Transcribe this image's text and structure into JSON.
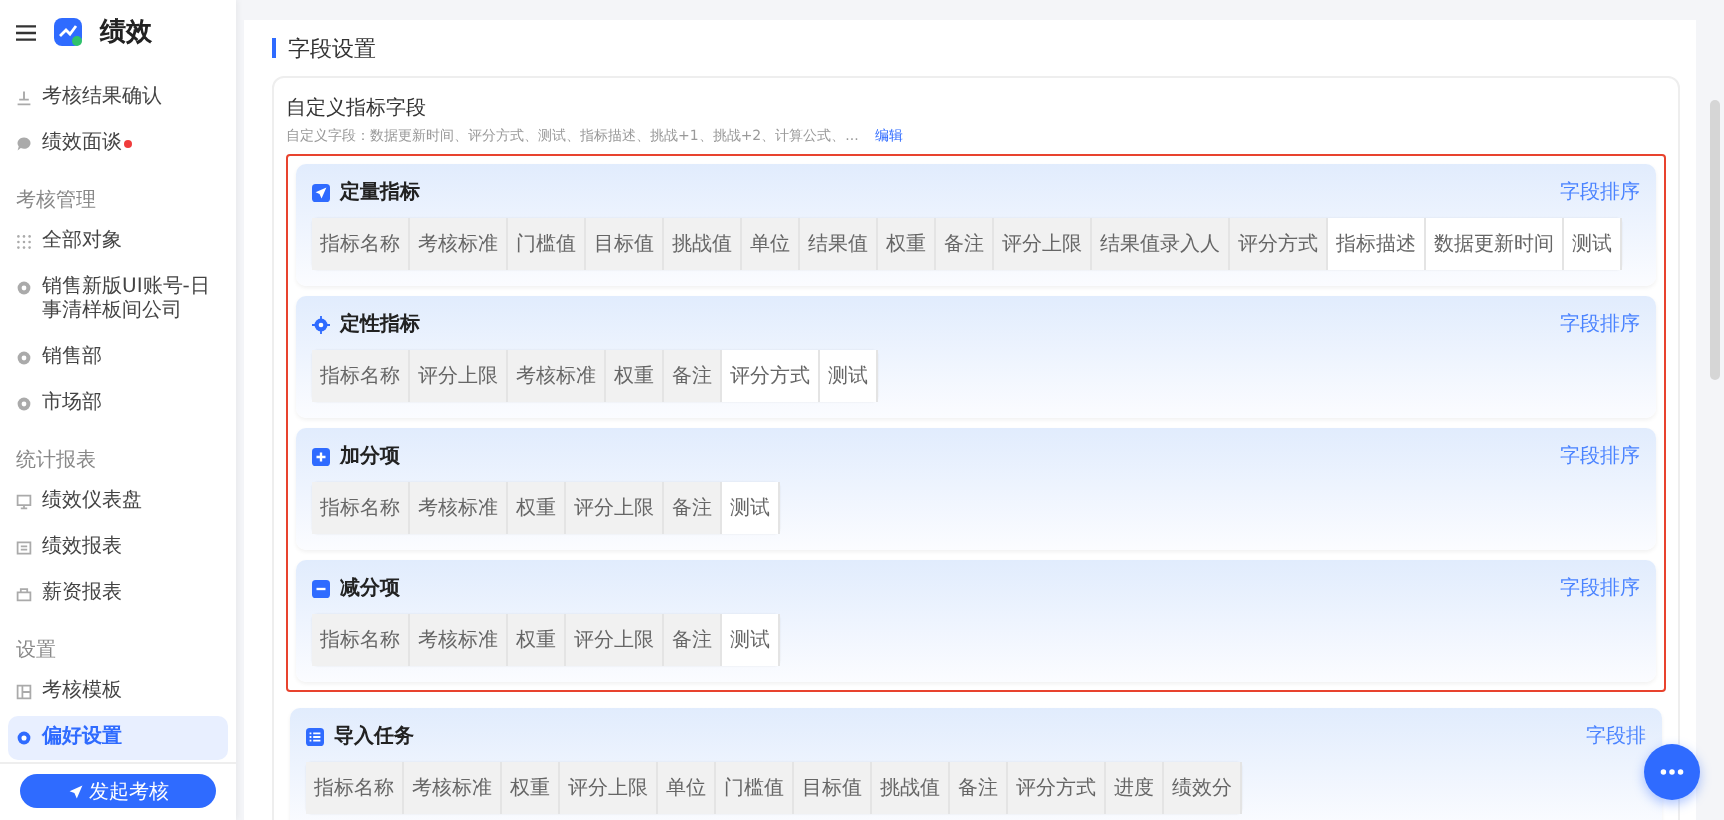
{
  "app": {
    "title": "绩效"
  },
  "sidebar": {
    "items": [
      {
        "label": "考核结果确认",
        "kind": "confirm",
        "selected": false,
        "dot": false
      },
      {
        "label": "绩效面谈",
        "kind": "chat",
        "selected": false,
        "dot": true
      }
    ],
    "groups": [
      {
        "label": "考核管理",
        "items": [
          {
            "label": "全部对象",
            "kind": "grid",
            "selected": false,
            "dot": false
          },
          {
            "label": "销售新版UI账号-日事清样板间公司",
            "kind": "org",
            "selected": false,
            "dot": false
          },
          {
            "label": "销售部",
            "kind": "org",
            "selected": false,
            "dot": false
          },
          {
            "label": "市场部",
            "kind": "org",
            "selected": false,
            "dot": false
          }
        ]
      },
      {
        "label": "统计报表",
        "items": [
          {
            "label": "绩效仪表盘",
            "kind": "monitor",
            "selected": false,
            "dot": false
          },
          {
            "label": "绩效报表",
            "kind": "report",
            "selected": false,
            "dot": false
          },
          {
            "label": "薪资报表",
            "kind": "wallet",
            "selected": false,
            "dot": false
          }
        ]
      },
      {
        "label": "设置",
        "items": [
          {
            "label": "考核模板",
            "kind": "template",
            "selected": false,
            "dot": false
          },
          {
            "label": "偏好设置",
            "kind": "gear",
            "selected": true,
            "dot": false
          }
        ]
      }
    ],
    "button": "发起考核"
  },
  "page": {
    "title": "字段设置",
    "custom": {
      "title": "自定义指标字段",
      "description": "自定义字段：数据更新时间、评分方式、测试、指标描述、挑战+1、挑战+2、计算公式、...",
      "link": "编辑"
    },
    "sections": [
      {
        "title": "定量指标",
        "kind": "quantitative",
        "highlighted": true,
        "sort": "字段排序",
        "fields": [
          {
            "label": "指标名称",
            "custom": false
          },
          {
            "label": "考核标准",
            "custom": false
          },
          {
            "label": "门槛值",
            "custom": false
          },
          {
            "label": "目标值",
            "custom": false
          },
          {
            "label": "挑战值",
            "custom": false
          },
          {
            "label": "单位",
            "custom": false
          },
          {
            "label": "结果值",
            "custom": false
          },
          {
            "label": "权重",
            "custom": false
          },
          {
            "label": "备注",
            "custom": false
          },
          {
            "label": "评分上限",
            "custom": false
          },
          {
            "label": "结果值录入人",
            "custom": false
          },
          {
            "label": "评分方式",
            "custom": false
          },
          {
            "label": "指标描述",
            "custom": true
          },
          {
            "label": "数据更新时间",
            "custom": true
          },
          {
            "label": "测试",
            "custom": true
          }
        ]
      },
      {
        "title": "定性指标",
        "kind": "qualitative",
        "highlighted": true,
        "sort": "字段排序",
        "fields": [
          {
            "label": "指标名称",
            "custom": false
          },
          {
            "label": "评分上限",
            "custom": false
          },
          {
            "label": "考核标准",
            "custom": false
          },
          {
            "label": "权重",
            "custom": false
          },
          {
            "label": "备注",
            "custom": false
          },
          {
            "label": "评分方式",
            "custom": true
          },
          {
            "label": "测试",
            "custom": true
          }
        ]
      },
      {
        "title": "加分项",
        "kind": "bonus",
        "highlighted": true,
        "sort": "字段排序",
        "fields": [
          {
            "label": "指标名称",
            "custom": false
          },
          {
            "label": "考核标准",
            "custom": false
          },
          {
            "label": "权重",
            "custom": false
          },
          {
            "label": "评分上限",
            "custom": false
          },
          {
            "label": "备注",
            "custom": false
          },
          {
            "label": "测试",
            "custom": true
          }
        ]
      },
      {
        "title": "减分项",
        "kind": "deduction",
        "highlighted": true,
        "sort": "字段排序",
        "fields": [
          {
            "label": "指标名称",
            "custom": false
          },
          {
            "label": "考核标准",
            "custom": false
          },
          {
            "label": "权重",
            "custom": false
          },
          {
            "label": "评分上限",
            "custom": false
          },
          {
            "label": "备注",
            "custom": false
          },
          {
            "label": "测试",
            "custom": true
          }
        ]
      },
      {
        "title": "导入任务",
        "kind": "import",
        "highlighted": false,
        "sort": "字段排",
        "fields": [
          {
            "label": "指标名称",
            "custom": false
          },
          {
            "label": "考核标准",
            "custom": false
          },
          {
            "label": "权重",
            "custom": false
          },
          {
            "label": "评分上限",
            "custom": false
          },
          {
            "label": "单位",
            "custom": false
          },
          {
            "label": "门槛值",
            "custom": false
          },
          {
            "label": "目标值",
            "custom": false
          },
          {
            "label": "挑战值",
            "custom": false
          },
          {
            "label": "备注",
            "custom": false
          },
          {
            "label": "评分方式",
            "custom": false
          },
          {
            "label": "进度",
            "custom": false
          },
          {
            "label": "绩效分",
            "custom": false
          }
        ]
      }
    ]
  }
}
